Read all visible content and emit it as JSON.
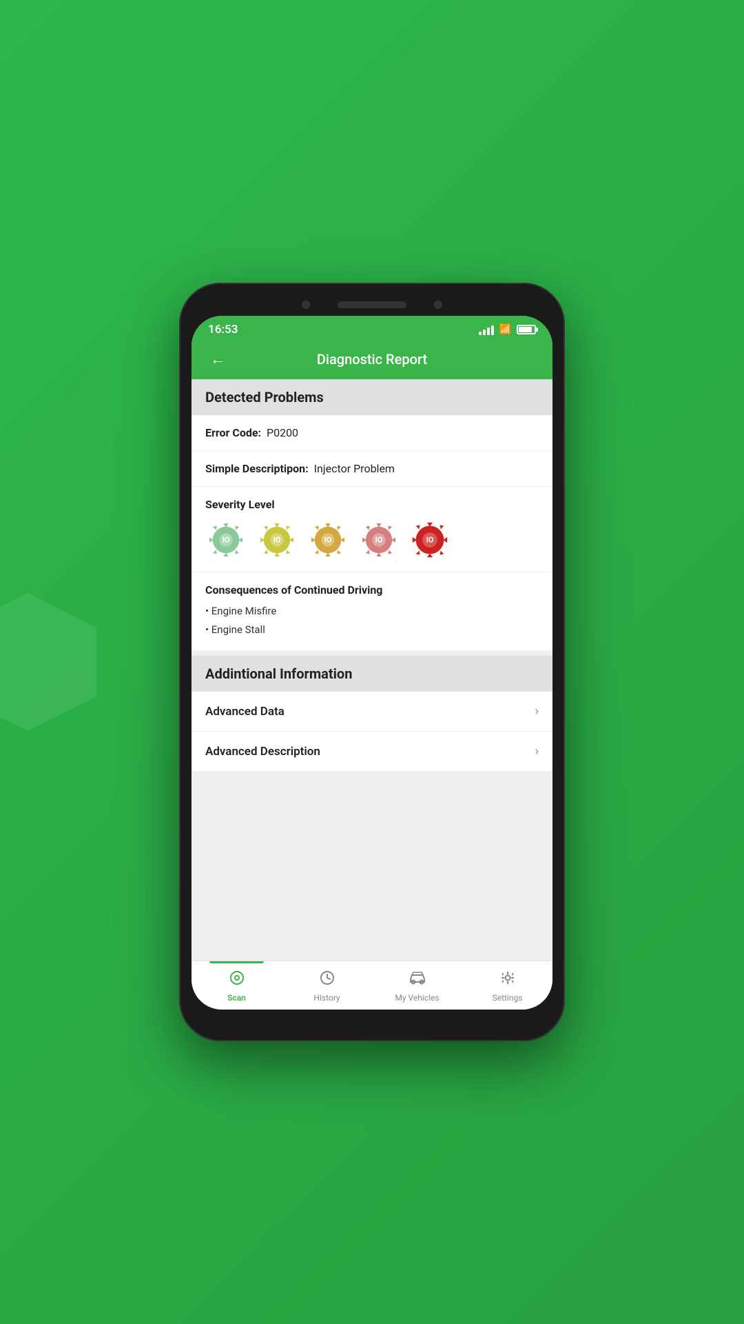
{
  "statusBar": {
    "time": "16:53"
  },
  "header": {
    "title": "Diagnostic Report",
    "backLabel": "←"
  },
  "detectedProblems": {
    "sectionTitle": "Detected Problems",
    "errorCodeLabel": "Error Code:",
    "errorCodeValue": "P0200",
    "simpleDescLabel": "Simple Descriptipon:",
    "simpleDescValue": "Injector Problem",
    "severityLabel": "Severity Level",
    "consequencesTitle": "Consequences of Continued Driving",
    "consequences": [
      "Engine Misfire",
      "Engine Stall"
    ]
  },
  "additionalInfo": {
    "sectionTitle": "Addintional Information",
    "rows": [
      {
        "label": "Advanced Data"
      },
      {
        "label": "Advanced Description"
      }
    ]
  },
  "bottomNav": {
    "items": [
      {
        "id": "scan",
        "label": "Scan",
        "active": true
      },
      {
        "id": "history",
        "label": "History",
        "active": false
      },
      {
        "id": "my-vehicles",
        "label": "My Vehicles",
        "active": false
      },
      {
        "id": "settings",
        "label": "Settings",
        "active": false
      }
    ]
  },
  "severityColors": [
    "#8bc99a",
    "#c8c840",
    "#d4a840",
    "#d48080",
    "#cc2222"
  ],
  "icons": {
    "back": "←",
    "chevron": "›",
    "scan": "⊙",
    "history": "◷",
    "myVehicles": "🚗",
    "settings": "⚙"
  }
}
